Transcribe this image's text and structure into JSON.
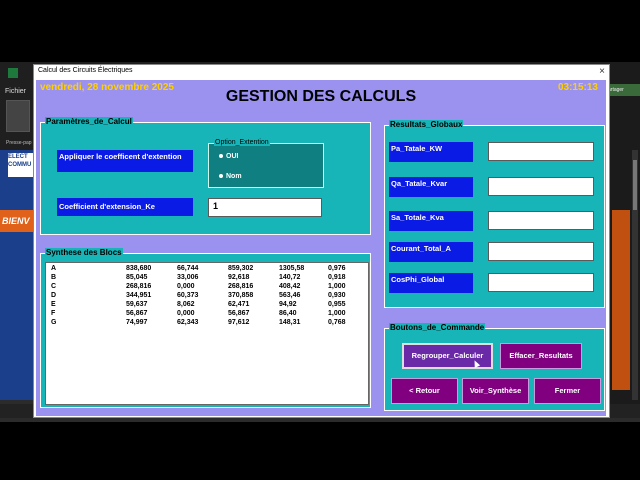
{
  "window": {
    "title": "Calcul des Circuits Électriques",
    "close_glyph": "×"
  },
  "background": {
    "fichier": "Fichier",
    "paste_label": "Presse-pap",
    "logo": "ELECT COMMU",
    "banner": "BIENV",
    "share": "artager"
  },
  "header": {
    "date": "vendredi, 28 novembre  2025",
    "time": "03:15:13",
    "title": "GESTION DES CALCULS"
  },
  "params": {
    "legend": "Paramètres_de_Calcul",
    "apply_label": "Appliquer le coefficent d'extention",
    "coef_label": "Coefficient d'extension_Ke",
    "coef_value": "1",
    "option_legend": "Option_Extention",
    "option_oui": "OUI",
    "option_non": "Nom"
  },
  "results": {
    "legend": "Resultats_Globaux",
    "fields": [
      {
        "label": "Pa_Tatale_KW",
        "value": ""
      },
      {
        "label": "Qa_Tatale_Kvar",
        "value": ""
      },
      {
        "label": "Sa_Totale_Kva",
        "value": ""
      },
      {
        "label": "Courant_Total_A",
        "value": ""
      },
      {
        "label": "CosPhi_Global",
        "value": ""
      }
    ]
  },
  "synthese": {
    "legend": "Synthese des Blocs",
    "rows": [
      [
        "A",
        "838,680",
        "66,744",
        "859,302",
        "1305,58",
        "0,976"
      ],
      [
        "B",
        "85,045",
        "33,006",
        "92,618",
        "140,72",
        "0,918"
      ],
      [
        "C",
        "268,816",
        "0,000",
        "268,816",
        "408,42",
        "1,000"
      ],
      [
        "D",
        "344,951",
        "60,373",
        "370,858",
        "563,46",
        "0,930"
      ],
      [
        "E",
        "59,637",
        "8,062",
        "62,471",
        "94,92",
        "0,955"
      ],
      [
        "F",
        "56,867",
        "0,000",
        "56,867",
        "86,40",
        "1,000"
      ],
      [
        "G",
        "74,997",
        "62,343",
        "97,612",
        "148,31",
        "0,768"
      ]
    ]
  },
  "commands": {
    "legend": "Boutons_de_Commande",
    "regrouper": "Regrouper_Calculer",
    "effacer": "Effacer_Resultats",
    "retour": "<  Retour",
    "voir": "Voir_Synthèse",
    "fermer": "Fermer"
  },
  "colors": {
    "client_bg": "#9b92f0",
    "group_bg": "#18b5b8",
    "label_blue": "#0a1be6",
    "button_purple": "#800080",
    "header_text": "#ffd000"
  }
}
